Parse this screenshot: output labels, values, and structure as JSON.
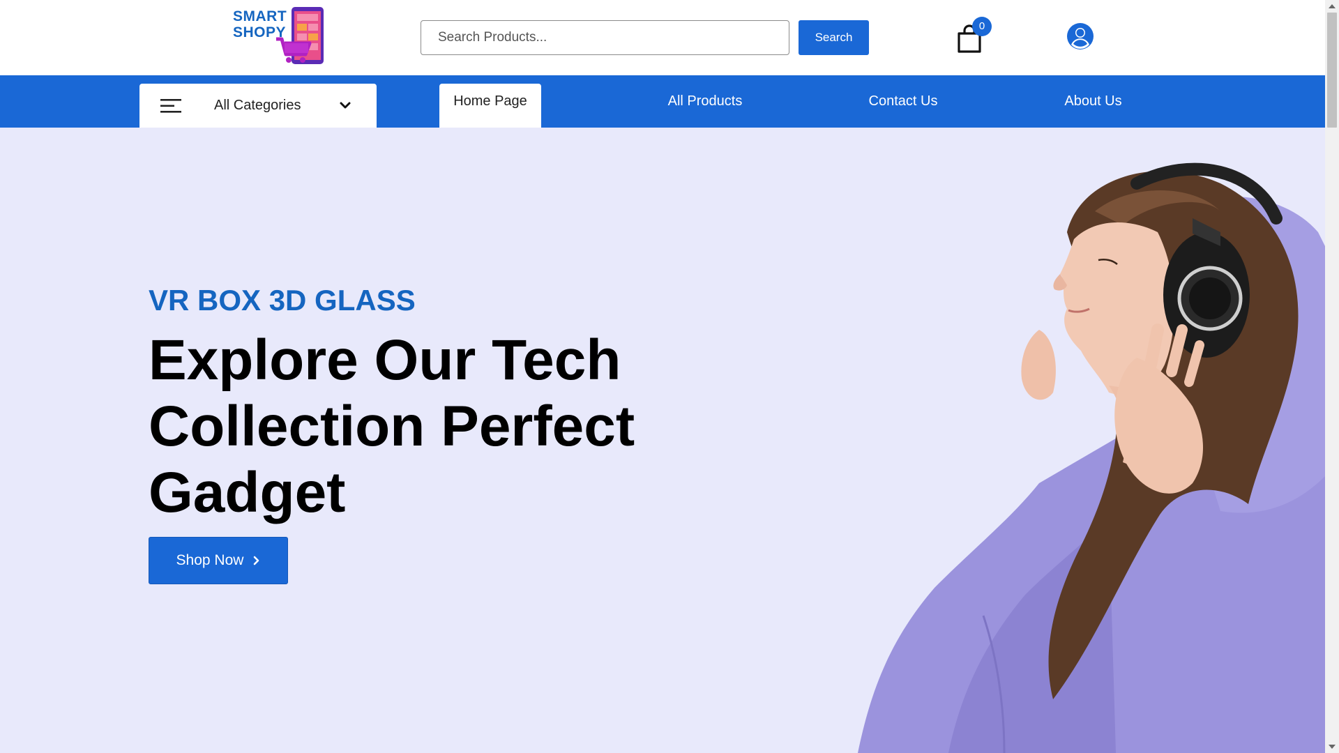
{
  "brand": {
    "name_line1": "SMART",
    "name_line2": "SHOPY",
    "primary_color": "#1a68d6",
    "logo_icon": "phone-cart-logo"
  },
  "header": {
    "search_placeholder": "Search Products...",
    "search_button": "Search",
    "cart_icon": "shopping-bag-icon",
    "cart_count": "0",
    "user_icon": "user-circle-icon"
  },
  "nav": {
    "categories_label": "All Categories",
    "tabs": [
      {
        "label": "Home Page",
        "active": true
      },
      {
        "label": "All Products",
        "active": false
      },
      {
        "label": "Contact Us",
        "active": false
      },
      {
        "label": "About Us",
        "active": false
      }
    ]
  },
  "hero": {
    "eyebrow": "VR BOX 3D GLASS",
    "title_line1": "Explore Our Tech",
    "title_line2": "Collection Perfect",
    "title_line3": "Gadget",
    "cta_label": "Shop Now",
    "background": "#e8e9fb"
  }
}
